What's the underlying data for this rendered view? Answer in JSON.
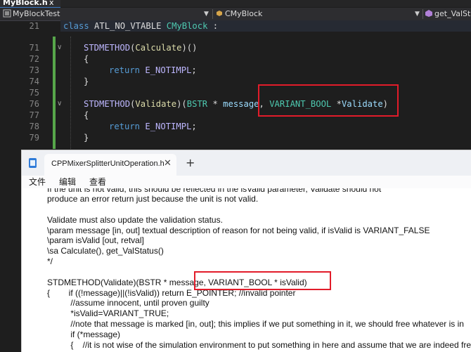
{
  "editor": {
    "file_tab": "MyBlock.h",
    "file_tab_close": "x",
    "nav": {
      "project": "MyBlockTest",
      "class_scope": "CMyBlock",
      "member": "get_ValStat"
    },
    "sticky_line_number": "21",
    "sticky_line": [
      "class",
      " ATL_NO_VTABLE ",
      "CMyBlock",
      " :"
    ],
    "lines": [
      {
        "num": "71",
        "parts": [
          "STDMETHOD",
          "(",
          "Calculate",
          ")()"
        ]
      },
      {
        "num": "72",
        "text": "{"
      },
      {
        "num": "73",
        "parts": [
          "return",
          " ",
          "E_NOTIMPL",
          ";"
        ]
      },
      {
        "num": "74",
        "text": "}"
      },
      {
        "num": "75",
        "text": ""
      },
      {
        "num": "76",
        "parts": [
          "STDMETHOD",
          "(",
          "Validate",
          ")(",
          "BSTR",
          " * ",
          "message",
          ", ",
          "VARIANT_BOOL",
          " *",
          "Validate",
          ")"
        ]
      },
      {
        "num": "77",
        "text": "{"
      },
      {
        "num": "78",
        "parts": [
          "return",
          " ",
          "E_NOTIMPL",
          ";"
        ]
      },
      {
        "num": "79",
        "text": "}"
      }
    ]
  },
  "notepad": {
    "tab_title": "CPPMixerSplitterUnitOperation.h",
    "tab_close": "✕",
    "new_tab": "+",
    "menu": [
      "文件",
      "编辑",
      "查看"
    ],
    "text_lines": [
      "If the unit is not valid, this should be reflected in the isValid parameter, Validate should not",
      "produce an error return just because the unit is not valid.",
      "",
      "Validate must also update the validation status.",
      "\\param message [in, out] textual description of reason for not being valid, if isValid is VARIANT_FALSE",
      "\\param isValid [out, retval]",
      "\\sa Calculate(), get_ValStatus()",
      "*/",
      "",
      "STDMETHOD(Validate)(BSTR * message, VARIANT_BOOL * isValid)",
      "{        if ((!message)||(!isValid)) return E_POINTER; //invalid pointer",
      "          //assume innocent, until proven guilty",
      "          *isValid=VARIANT_TRUE;",
      "          //note that message is marked [in, out]; this implies if we put something in it, we should free whatever is in",
      "          if (*message)",
      "          {    //it is not wise of the simulation environment to put something in here and assume that we are indeed fre"
    ]
  },
  "colors": {
    "editor_bg": "#1e1e1e",
    "highlight_box": "#e21c2a",
    "change_bar": "#57a64a"
  }
}
